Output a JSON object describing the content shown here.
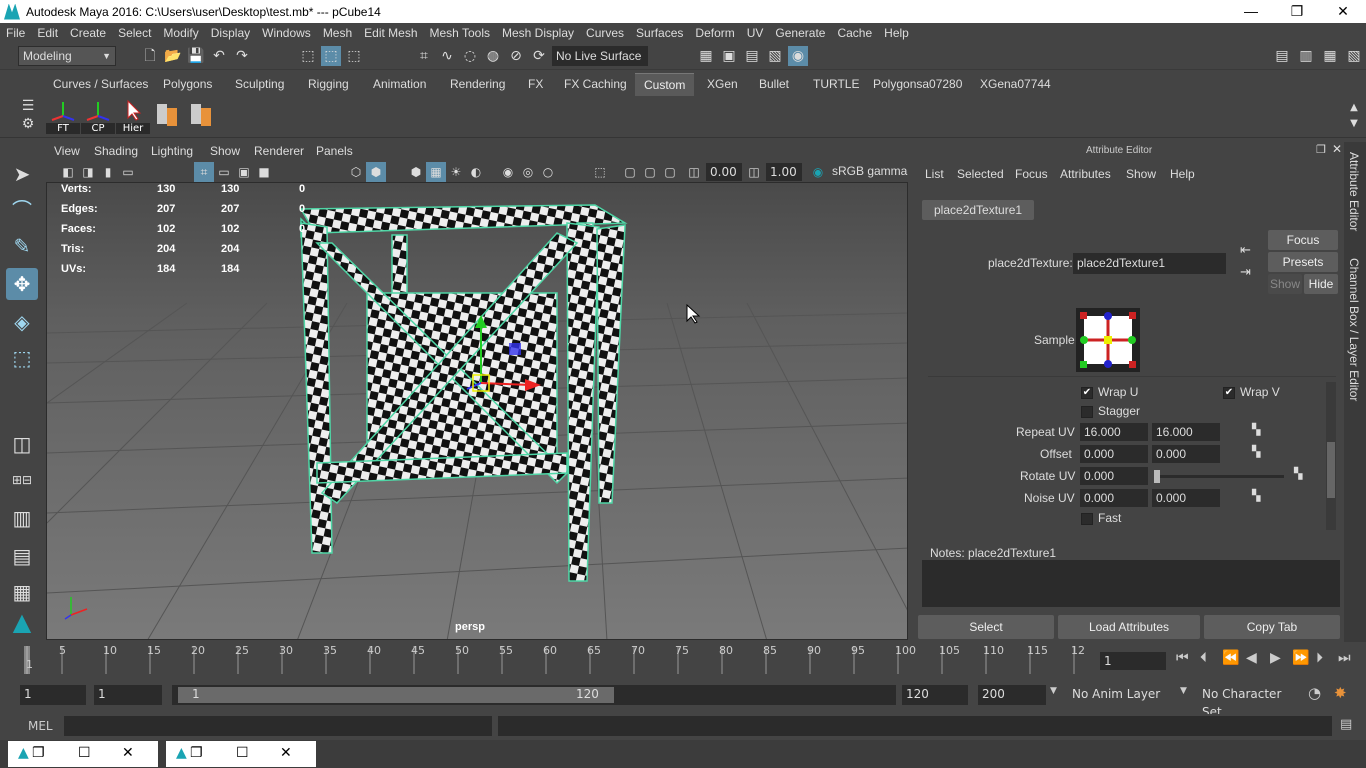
{
  "title": "Autodesk Maya 2016: C:\\Users\\user\\Desktop\\test.mb*   ---   pCube14",
  "window_controls": [
    "—",
    "❐",
    "✕"
  ],
  "menus": [
    "File",
    "Edit",
    "Create",
    "Select",
    "Modify",
    "Display",
    "Windows",
    "Mesh",
    "Edit Mesh",
    "Mesh Tools",
    "Mesh Display",
    "Curves",
    "Surfaces",
    "Deform",
    "UV",
    "Generate",
    "Cache",
    "Help"
  ],
  "status": {
    "mode": "Modeling",
    "live_surface": "No Live Surface"
  },
  "shelf_tabs": [
    "Curves / Surfaces",
    "Polygons",
    "Sculpting",
    "Rigging",
    "Animation",
    "Rendering",
    "FX",
    "FX Caching",
    "Custom",
    "XGen",
    "Bullet",
    "TURTLE",
    "Polygonsa07280",
    "XGena07744"
  ],
  "active_shelf_tab": "Custom",
  "shelf_items": [
    "FT",
    "CP",
    "Hier"
  ],
  "panel_menu": [
    "View",
    "Shading",
    "Lighting",
    "Show",
    "Renderer",
    "Panels"
  ],
  "panel_tools": {
    "exposure": "0.00",
    "gamma": "1.00",
    "color_space": "sRGB gamma"
  },
  "hud": {
    "rows": [
      {
        "label": "Verts:",
        "a": "130",
        "b": "130",
        "c": "0"
      },
      {
        "label": "Edges:",
        "a": "207",
        "b": "207",
        "c": "0"
      },
      {
        "label": "Faces:",
        "a": "102",
        "b": "102",
        "c": "0"
      },
      {
        "label": "Tris:",
        "a": "204",
        "b": "204",
        "c": ""
      },
      {
        "label": "UVs:",
        "a": "184",
        "b": "184",
        "c": ""
      }
    ],
    "camera": "persp"
  },
  "attr_editor": {
    "title": "Attribute Editor",
    "menus": [
      "List",
      "Selected",
      "Focus",
      "Attributes",
      "Show",
      "Help"
    ],
    "tab": "place2dTexture1",
    "node_label": "place2dTexture:",
    "node_value": "place2dTexture1",
    "buttons": {
      "focus": "Focus",
      "presets": "Presets",
      "show": "Show",
      "hide": "Hide"
    },
    "sample_label": "Sample",
    "wrap_u": "Wrap U",
    "wrap_v": "Wrap V",
    "stagger": "Stagger",
    "repeat_uv": {
      "label": "Repeat UV",
      "u": "16.000",
      "v": "16.000"
    },
    "offset": {
      "label": "Offset",
      "u": "0.000",
      "v": "0.000"
    },
    "rotate_uv": {
      "label": "Rotate UV",
      "value": "0.000"
    },
    "noise_uv": {
      "label": "Noise UV",
      "u": "0.000",
      "v": "0.000"
    },
    "fast": "Fast",
    "notes_label": "Notes:  place2dTexture1",
    "bottom_buttons": [
      "Select",
      "Load Attributes",
      "Copy Tab"
    ]
  },
  "side_tabs": [
    "Attribute Editor",
    "Channel Box / Layer Editor"
  ],
  "timeline": {
    "ticks": [
      "1",
      "5",
      "10",
      "15",
      "20",
      "25",
      "30",
      "35",
      "40",
      "45",
      "50",
      "55",
      "60",
      "65",
      "70",
      "75",
      "80",
      "85",
      "90",
      "95",
      "100",
      "105",
      "110",
      "115",
      "12"
    ],
    "current_frame": "1"
  },
  "range": {
    "start": "1",
    "start2": "1",
    "range_start": "1",
    "range_end": "120",
    "end": "120",
    "end2": "200",
    "anim_layer": "No Anim Layer",
    "char_set": "No Character Set"
  },
  "cmdline": {
    "label": "MEL"
  }
}
